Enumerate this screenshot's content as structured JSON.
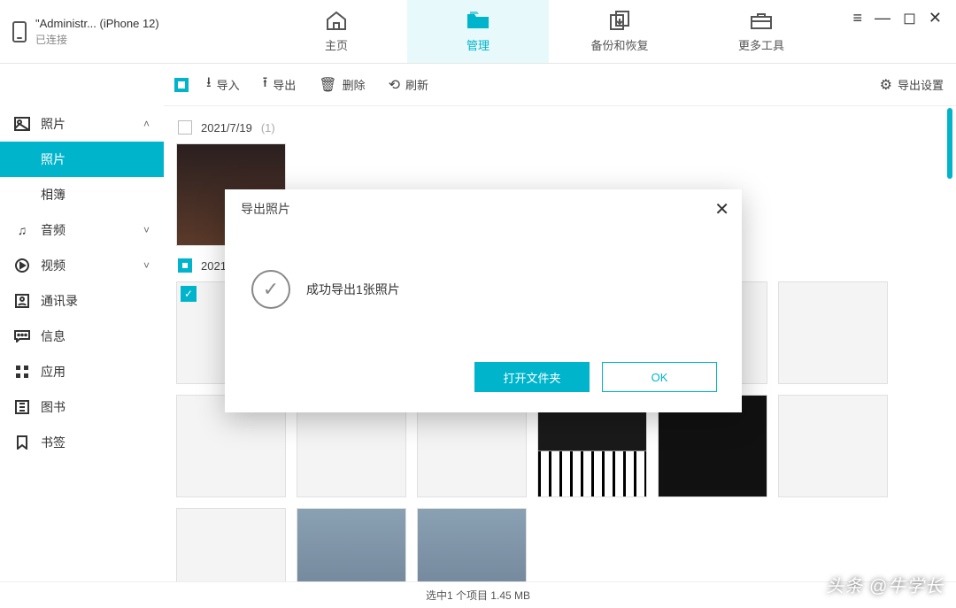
{
  "device": {
    "name": "\"Administr... (iPhone 12)",
    "status": "已连接"
  },
  "tabs": {
    "home": {
      "label": "主页"
    },
    "manage": {
      "label": "管理"
    },
    "backup": {
      "label": "备份和恢复"
    },
    "tools": {
      "label": "更多工具"
    }
  },
  "toolbar": {
    "import": "导入",
    "export": "导出",
    "delete": "删除",
    "refresh": "刷新",
    "settings": "导出设置"
  },
  "sidebar": {
    "photos_cat": "照片",
    "photos": "照片",
    "albums": "相簿",
    "audio": "音频",
    "video": "视频",
    "contacts": "通讯录",
    "messages": "信息",
    "apps": "应用",
    "books": "图书",
    "bookmarks": "书签"
  },
  "groups": [
    {
      "date": "2021/7/19",
      "count": "(1)",
      "selected": false
    },
    {
      "date": "2021",
      "count": "",
      "selected": true
    }
  ],
  "dialog": {
    "title": "导出照片",
    "message": "成功导出1张照片",
    "open_folder": "打开文件夹",
    "ok": "OK"
  },
  "status": "选中1 个项目 1.45 MB",
  "watermark": "头条 @牛学长"
}
